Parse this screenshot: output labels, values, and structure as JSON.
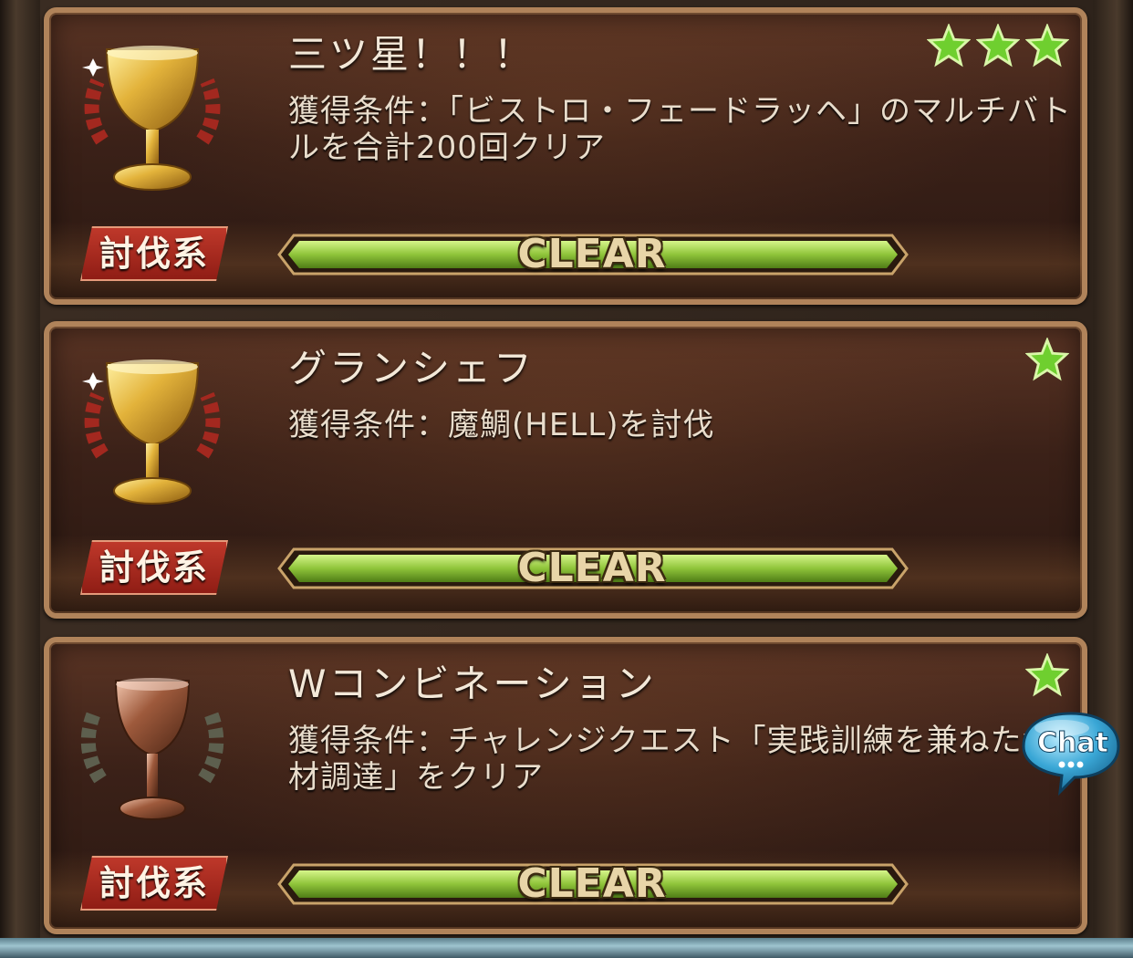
{
  "achievements": [
    {
      "title": "三ツ星！！！",
      "description": "獲得条件：「ビストロ・フェードラッヘ」のマルチバトルを合計200回クリア",
      "stars": 3,
      "category": "討伐系",
      "status": "CLEAR",
      "progress": 1.0,
      "trophy": "gold-trophy-icon"
    },
    {
      "title": "グランシェフ",
      "description": "獲得条件：魔鯛(HELL)を討伐",
      "stars": 1,
      "category": "討伐系",
      "status": "CLEAR",
      "progress": 1.0,
      "trophy": "gold-trophy-icon"
    },
    {
      "title": "Wコンビネーション",
      "description": "獲得条件：チャレンジクエスト「実践訓練を兼ねた食材調達」をクリア",
      "stars": 1,
      "category": "討伐系",
      "status": "CLEAR",
      "progress": 1.0,
      "trophy": "bronze-trophy-icon"
    }
  ],
  "chat": {
    "label": "Chat",
    "icon": "chat-bubble-icon"
  },
  "colors": {
    "star": "#6fcf2f",
    "bar": "#8fc43a",
    "badge": "#b3261e",
    "frame": "#b0835a"
  }
}
